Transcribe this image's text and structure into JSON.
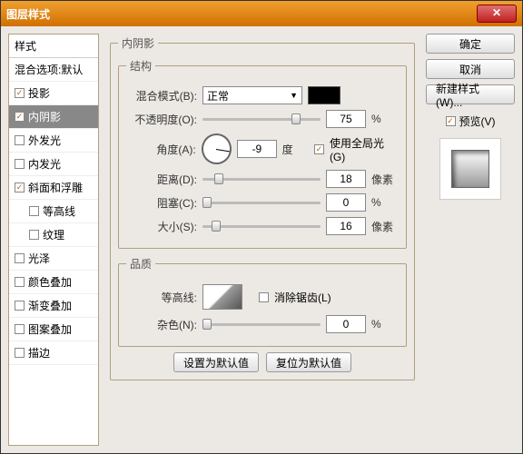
{
  "window": {
    "title": "图层样式"
  },
  "left": {
    "header": "样式",
    "blendOptions": "混合选项:默认"
  },
  "styles": [
    {
      "label": "投影",
      "checked": true,
      "selected": false
    },
    {
      "label": "内阴影",
      "checked": true,
      "selected": true
    },
    {
      "label": "外发光",
      "checked": false,
      "selected": false
    },
    {
      "label": "内发光",
      "checked": false,
      "selected": false
    },
    {
      "label": "斜面和浮雕",
      "checked": true,
      "selected": false
    },
    {
      "label": "等高线",
      "checked": false,
      "selected": false,
      "indent": true
    },
    {
      "label": "纹理",
      "checked": false,
      "selected": false,
      "indent": true
    },
    {
      "label": "光泽",
      "checked": false,
      "selected": false
    },
    {
      "label": "颜色叠加",
      "checked": false,
      "selected": false
    },
    {
      "label": "渐变叠加",
      "checked": false,
      "selected": false
    },
    {
      "label": "图案叠加",
      "checked": false,
      "selected": false
    },
    {
      "label": "描边",
      "checked": false,
      "selected": false
    }
  ],
  "panel": {
    "title": "内阴影",
    "structure": {
      "legend": "结构",
      "blendModeLabel": "混合模式(B):",
      "blendModeValue": "正常",
      "colorSwatch": "#000000",
      "opacityLabel": "不透明度(O):",
      "opacityValue": "75",
      "opacityUnit": "%",
      "angleLabel": "角度(A):",
      "angleValue": "-9",
      "angleUnit": "度",
      "useGlobalLabel": "使用全局光(G)",
      "useGlobalChecked": true,
      "distanceLabel": "距离(D):",
      "distanceValue": "18",
      "distanceUnit": "像素",
      "chokeLabel": "阻塞(C):",
      "chokeValue": "0",
      "chokeUnit": "%",
      "sizeLabel": "大小(S):",
      "sizeValue": "16",
      "sizeUnit": "像素"
    },
    "quality": {
      "legend": "品质",
      "contourLabel": "等高线:",
      "antiAliasLabel": "消除锯齿(L)",
      "antiAliasChecked": false,
      "noiseLabel": "杂色(N):",
      "noiseValue": "0",
      "noiseUnit": "%"
    },
    "buttons": {
      "setDefault": "设置为默认值",
      "resetDefault": "复位为默认值"
    }
  },
  "right": {
    "ok": "确定",
    "cancel": "取消",
    "newStyle": "新建样式(W)...",
    "previewLabel": "预览(V)",
    "previewChecked": true
  }
}
